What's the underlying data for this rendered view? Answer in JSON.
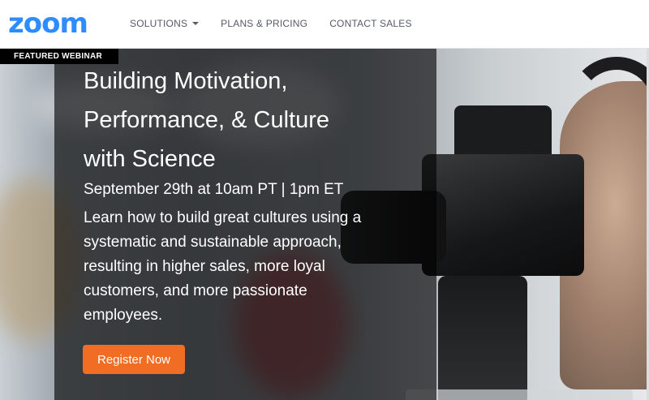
{
  "header": {
    "logo_text": "zoom",
    "nav": [
      {
        "label": "SOLUTIONS",
        "has_dropdown": true
      },
      {
        "label": "PLANS & PRICING",
        "has_dropdown": false
      },
      {
        "label": "CONTACT SALES",
        "has_dropdown": false
      }
    ]
  },
  "hero": {
    "badge": "FEATURED WEBINAR",
    "title_lines": [
      "Building Motivation,",
      "Performance, & Culture",
      "with Science"
    ],
    "date": "September 29th at 10am PT | 1pm ET",
    "description_lines": [
      "Learn how to build great cultures using a",
      "systematic and sustainable approach,",
      "resulting in higher sales, more loyal",
      "customers, and more passionate",
      "employees."
    ],
    "cta_label": "Register Now",
    "background_icon": "camera-operator-photo"
  },
  "colors": {
    "brand": "#2d8cff",
    "cta": "#f06d23",
    "nav_text": "#555a65"
  }
}
